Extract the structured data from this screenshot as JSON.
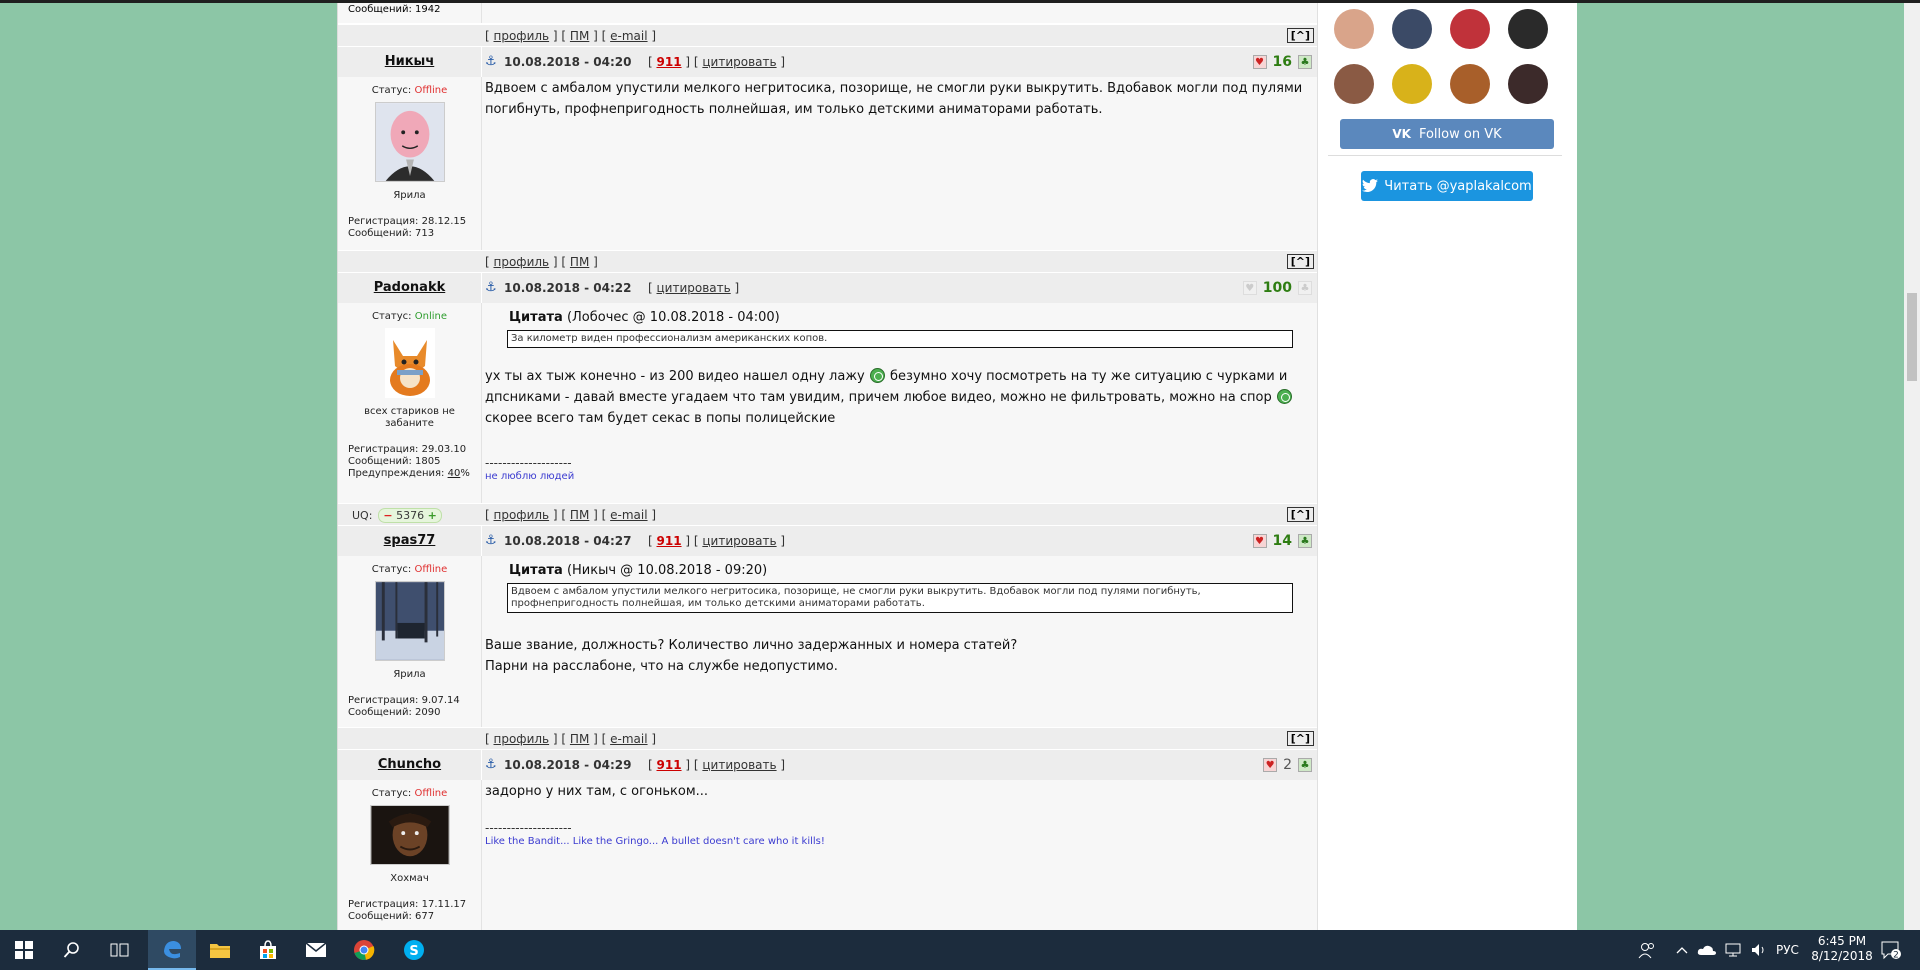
{
  "prev_post": {
    "posts_label": "Сообщений: 1942"
  },
  "links": {
    "profile": "профиль",
    "pm": "ПМ",
    "email": "e-mail",
    "quote": "цитировать",
    "up": "[^]"
  },
  "posts": [
    {
      "author": "Никыч",
      "date": "10.08.2018 - 04:20",
      "num": "911",
      "status_label": "Статус: ",
      "status": "Offline",
      "user_title": "Ярила",
      "reg": "Регистрация: 28.12.15",
      "posts_count": "Сообщений: 713",
      "score": "16",
      "text": "Вдвоем с амбалом упустили мелкого негритосика, позорище, не смогли руки выкрутить. Вдобавок могли под пулями погибнуть, профнепригодность полнейшая, им только детскими аниматорами работать."
    },
    {
      "author": "Padonakk",
      "date": "10.08.2018 - 04:22",
      "status_label": "Статус: ",
      "status": "Online",
      "user_title": "всех стариков не забаните",
      "reg": "Регистрация: 29.03.10",
      "posts_count": "Сообщений: 1805",
      "warn_label": "Предупреждения: ",
      "warn_value": "40",
      "warn_suffix": "%",
      "score": "100",
      "quote_label": "Цитата",
      "quote_source": "(Лобочес @ 10.08.2018 - 04:00)",
      "quote_text": "За километр виден профессионализм американских копов.",
      "text_1": "ух ты ах тыж конечно - из 200 видео нашел одну лажу",
      "text_2": "безумно хочу посмотреть на ту же ситуацию с чурками и",
      "text_3": "дпсниками - давай вместе угадаем что там увидим, причем любое видео, можно не фильтровать, можно на спор",
      "text_4": "скорее всего там будет секас в попы полицейские",
      "sig_line": "--------------------",
      "signature": "не люблю людей",
      "uq_label": "UQ:",
      "uq_value": "5376"
    },
    {
      "author": "spas77",
      "date": "10.08.2018 - 04:27",
      "num": "911",
      "status_label": "Статус: ",
      "status": "Offline",
      "user_title": "Ярила",
      "reg": "Регистрация: 9.07.14",
      "posts_count": "Сообщений: 2090",
      "score": "14",
      "quote_label": "Цитата",
      "quote_source": "(Никыч @ 10.08.2018 - 09:20)",
      "quote_text": "Вдвоем с амбалом упустили мелкого негритосика, позорище, не смогли руки выкрутить. Вдобавок могли под пулями погибнуть, профнепригодность полнейшая, им только детскими аниматорами работать.",
      "text_1": "Ваше звание, должность? Количество лично задержанных и номера статей?",
      "text_2": "Парни на расслабоне, что на службе недопустимо."
    },
    {
      "author": "Chuncho",
      "date": "10.08.2018 - 04:29",
      "num": "911",
      "status_label": "Статус: ",
      "status": "Offline",
      "user_title": "Хохмач",
      "reg": "Регистрация: 17.11.17",
      "posts_count": "Сообщений: 677",
      "score": "2",
      "text": "задорно у них там, с огоньком...",
      "sig_line": "--------------------",
      "signature": "Like the Bandit... Like the Gringo... A bullet doesn't care who it kills!"
    }
  ],
  "sidebar": {
    "vk_label": "Follow on VK",
    "twitter_label": "Читать @yaplakalcom",
    "friend_colors": [
      "#d9a48a",
      "#3b4a66",
      "#c0323a",
      "#2a2a2a",
      "#8a5a44",
      "#d8b21a",
      "#a85f2a",
      "#3c2a2a"
    ]
  },
  "taskbar": {
    "lang": "РУС",
    "time": "6:45 PM",
    "date": "8/12/2018",
    "notifications": "2"
  }
}
